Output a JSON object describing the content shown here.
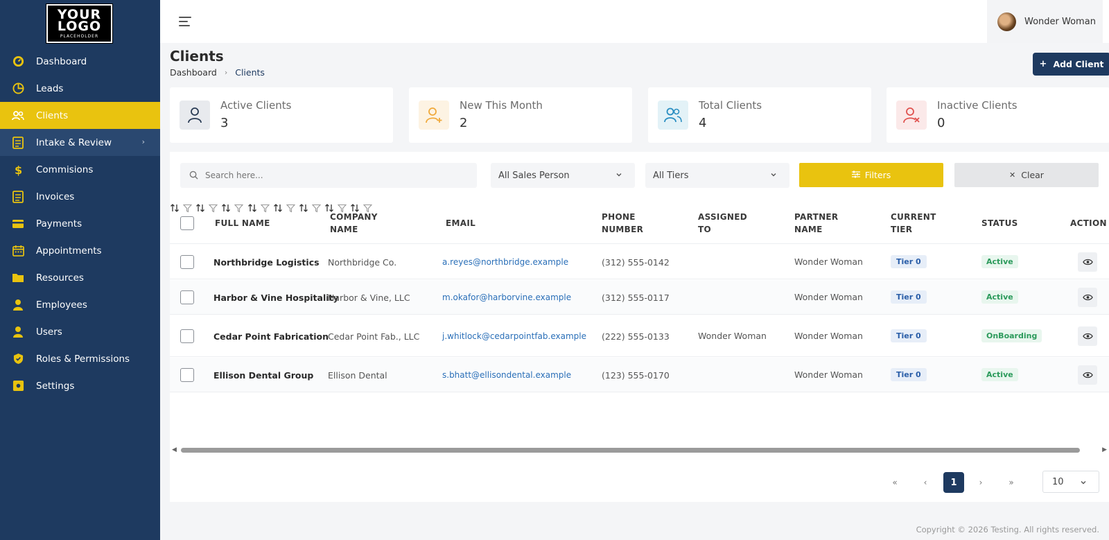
{
  "brand": {
    "logo_line1": "YOUR",
    "logo_line2": "LOGO",
    "logo_line3": "PLACEHOLDER"
  },
  "colors": {
    "sidebar": "#1e3a60",
    "accent": "#e9c30f",
    "primary": "#1e3a60"
  },
  "sidebar": {
    "items": [
      {
        "label": "Dashboard",
        "icon": "dashboard-gauge-icon"
      },
      {
        "label": "Leads",
        "icon": "pie-chart-icon"
      },
      {
        "label": "Clients",
        "icon": "users-icon"
      },
      {
        "label": "Intake & Review",
        "icon": "list-check-icon"
      },
      {
        "label": "Commisions",
        "icon": "dollar-icon"
      },
      {
        "label": "Invoices",
        "icon": "invoice-icon"
      },
      {
        "label": "Payments",
        "icon": "credit-card-icon"
      },
      {
        "label": "Appointments",
        "icon": "calendar-icon"
      },
      {
        "label": "Resources",
        "icon": "folder-icon"
      },
      {
        "label": "Employees",
        "icon": "employee-icon"
      },
      {
        "label": "Users",
        "icon": "user-icon"
      },
      {
        "label": "Roles & Permissions",
        "icon": "shield-icon"
      },
      {
        "label": "Settings",
        "icon": "settings-icon"
      }
    ]
  },
  "header": {
    "user_name": "Wonder Woman"
  },
  "page": {
    "title": "Clients",
    "breadcrumb": [
      "Dashboard",
      "Clients"
    ],
    "add_button": "Add Client"
  },
  "stats": [
    {
      "label": "Active Clients",
      "value": "3"
    },
    {
      "label": "New This Month",
      "value": "2"
    },
    {
      "label": "Total Clients",
      "value": "4"
    },
    {
      "label": "Inactive Clients",
      "value": "0"
    }
  ],
  "toolbar": {
    "search_placeholder": "Search here...",
    "sales_person": "All Sales Person",
    "tiers": "All Tiers",
    "filters_label": "Filters",
    "clear_label": "Clear"
  },
  "table": {
    "columns": {
      "full_name": "FULL NAME",
      "company_1": "COMPANY",
      "company_2": "NAME",
      "email": "EMAIL",
      "phone_1": "PHONE",
      "phone_2": "NUMBER",
      "assigned_1": "ASSIGNED",
      "assigned_2": "TO",
      "partner_1": "PARTNER",
      "partner_2": "NAME",
      "tier_1": "CURRENT",
      "tier_2": "TIER",
      "status": "STATUS",
      "action": "ACTION"
    },
    "rows": [
      {
        "name": "Northbridge Logistics",
        "company": "Northbridge Co.",
        "email": "a.reyes@northbridge.example",
        "phone": "(312) 555-0142",
        "assigned": "",
        "partner": "Wonder Woman",
        "tier": "Tier 0",
        "status": "Active"
      },
      {
        "name": "Harbor & Vine Hospitality",
        "company": "Harbor & Vine, LLC",
        "email": "m.okafor@harborvine.example",
        "phone": "(312) 555-0117",
        "assigned": "",
        "partner": "Wonder Woman",
        "tier": "Tier 0",
        "status": "Active"
      },
      {
        "name": "Cedar Point Fabrication",
        "company": "Cedar Point Fab., LLC",
        "email": "j.whitlock@cedarpointfab.example",
        "phone": "(222) 555-0133",
        "assigned": "Wonder Woman",
        "partner": "Wonder Woman",
        "tier": "Tier 0",
        "status": "OnBoarding"
      },
      {
        "name": "Ellison Dental Group",
        "company": "Ellison Dental",
        "email": "s.bhatt@ellisondental.example",
        "phone": "(123) 555-0170",
        "assigned": "",
        "partner": "Wonder Woman",
        "tier": "Tier 0",
        "status": "Active"
      }
    ]
  },
  "pagination": {
    "current_page": "1",
    "page_size": "10"
  },
  "footer": {
    "copyright": "Copyright © 2026 Testing. All rights reserved."
  }
}
